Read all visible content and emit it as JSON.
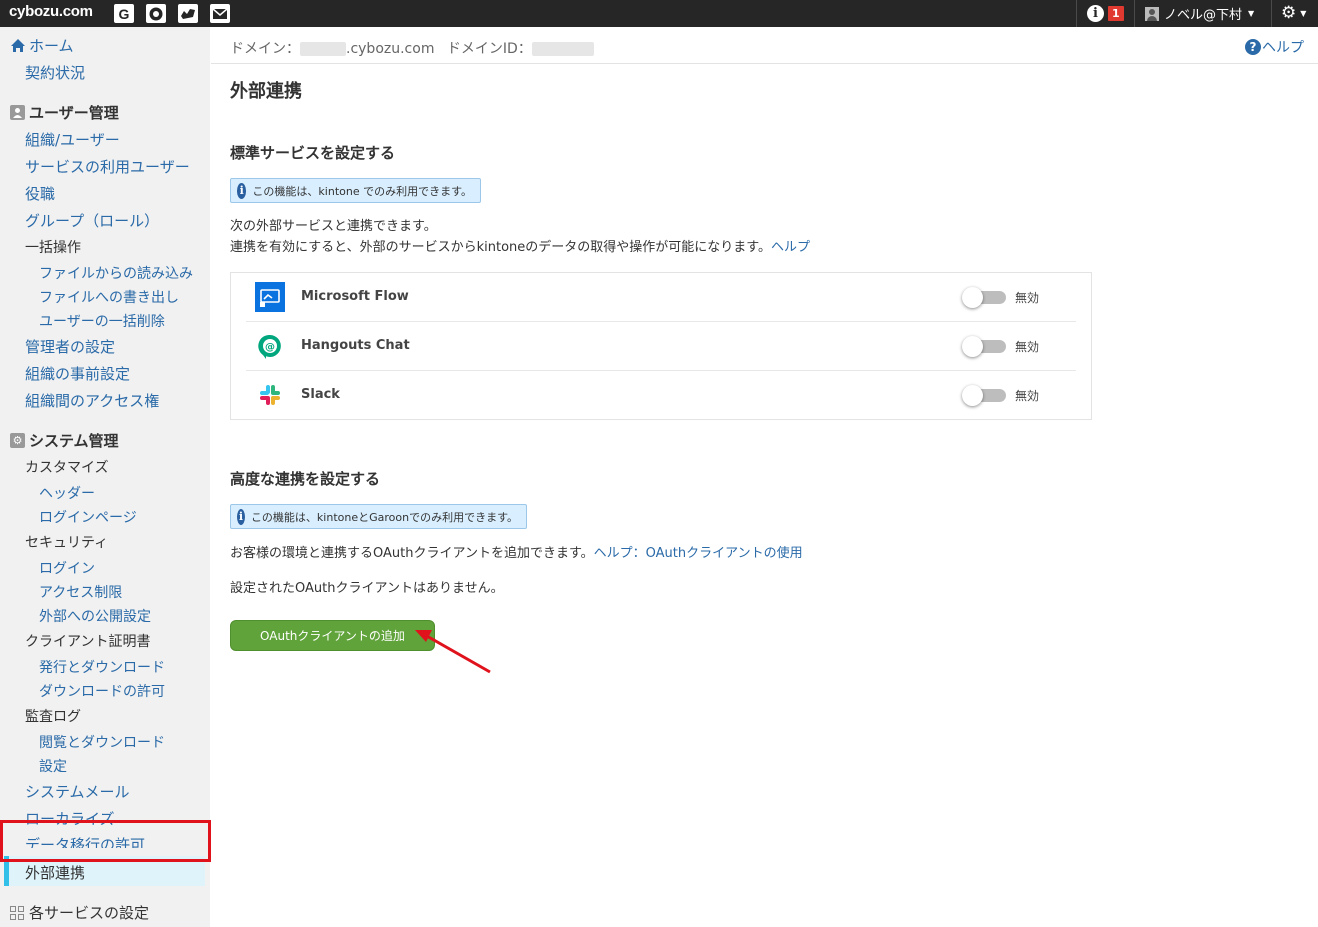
{
  "topbar": {
    "logo": "cybozu.com",
    "apps": [
      {
        "icon": "g-app-icon",
        "label": "G"
      },
      {
        "icon": "office-app-icon"
      },
      {
        "icon": "mailwise-app-icon"
      },
      {
        "icon": "mail-app-icon"
      }
    ],
    "notification_count": "1",
    "user": "ノベル@下村",
    "colors": {
      "bg": "#262626",
      "badge": "#e03a30"
    }
  },
  "sidebar": {
    "home": "ホーム",
    "contract": "契約状況",
    "user_mgmt_heading": "ユーザー管理",
    "user_items": [
      "組織/ユーザー",
      "サービスの利用ユーザー",
      "役職",
      "グループ（ロール）",
      "一括操作"
    ],
    "bulk_sub": [
      "ファイルからの読み込み",
      "ファイルへの書き出し",
      "ユーザーの一括削除"
    ],
    "user_items2": [
      "管理者の設定",
      "組織の事前設定",
      "組織間のアクセス権"
    ],
    "sys_mgmt_heading": "システム管理",
    "customize": "カスタマイズ",
    "customize_sub": [
      "ヘッダー",
      "ログインページ"
    ],
    "security": "セキュリティ",
    "security_sub": [
      "ログイン",
      "アクセス制限",
      "外部への公開設定"
    ],
    "cert": "クライアント証明書",
    "cert_sub": [
      "発行とダウンロード",
      "ダウンロードの許可"
    ],
    "audit": "監査ログ",
    "audit_sub": [
      "閲覧とダウンロード",
      "設定"
    ],
    "sys_items": [
      "システムメール",
      "ローカライズ",
      "データ移行の許可"
    ],
    "active": "外部連携",
    "services_heading": "各サービスの設定"
  },
  "domain_bar": {
    "domain_label": "ドメイン：",
    "domain_suffix": ".cybozu.com",
    "domain_id_label": "ドメインID：",
    "help": "ヘルプ"
  },
  "main": {
    "title": "外部連携",
    "standard": {
      "heading": "標準サービスを設定する",
      "notice": "この機能は、kintone でのみ利用できます。",
      "desc1": "次の外部サービスと連携できます。",
      "desc2": "連携を有効にすると、外部のサービスからkintoneのデータの取得や操作が可能になります。",
      "help_link": "ヘルプ",
      "services": [
        {
          "name": "Microsoft Flow",
          "status": "無効",
          "icon": "microsoft-flow-icon"
        },
        {
          "name": "Hangouts Chat",
          "status": "無効",
          "icon": "hangouts-chat-icon"
        },
        {
          "name": "Slack",
          "status": "無効",
          "icon": "slack-icon"
        }
      ]
    },
    "advanced": {
      "heading": "高度な連携を設定する",
      "notice": "この機能は、kintoneとGaroonでのみ利用できます。",
      "desc": "お客様の環境と連携するOAuthクライアントを追加できます。",
      "help_link": "ヘルプ：OAuthクライアントの使用",
      "empty": "設定されたOAuthクライアントはありません。",
      "add_button": "OAuthクライアントの追加"
    }
  },
  "colors": {
    "link": "#2a6aa8",
    "button": "#60a33a",
    "highlight": "#e0121c",
    "active_bar": "#32c0e8"
  }
}
